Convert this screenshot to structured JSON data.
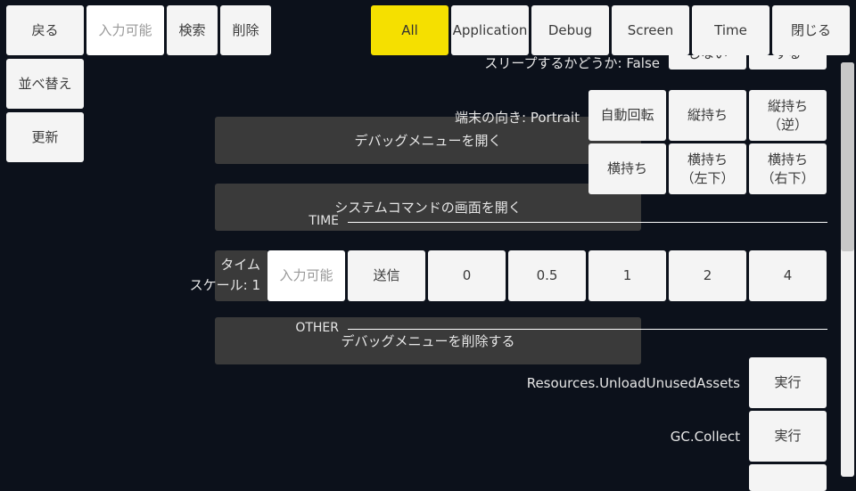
{
  "toolbar": {
    "back": "戻る",
    "search_placeholder": "入力可能",
    "search": "検索",
    "delete": "削除",
    "sort": "並べ替え",
    "refresh": "更新",
    "close": "閉じる"
  },
  "tabs": [
    "All",
    "Application",
    "Debug",
    "Screen",
    "Time"
  ],
  "accent": "#f5e000",
  "screen": {
    "sleep_label": "スリープするかどうか: False",
    "sleep_off": "しない",
    "sleep_on": "する",
    "orientation_label": "端末の向き: Portrait",
    "orientation_buttons": [
      "自動回転",
      "縦持ち",
      "縦持ち\n（逆）",
      "横持ち",
      "横持ち\n（左下）",
      "横持ち\n（右下）"
    ]
  },
  "debug": {
    "open_menu": "デバッグメニューを開く",
    "open_system": "システムコマンドの画面を開く",
    "delete_menu": "デバッグメニューを削除する"
  },
  "time": {
    "header": "TIME",
    "label": "タイム\nスケール: 1",
    "input_placeholder": "入力可能",
    "send": "送信",
    "presets": [
      "0",
      "0.5",
      "1",
      "2",
      "4"
    ]
  },
  "other": {
    "header": "OTHER",
    "items": [
      {
        "label": "Resources.UnloadUnusedAssets",
        "button": "実行"
      },
      {
        "label": "GC.Collect",
        "button": "実行"
      }
    ]
  }
}
